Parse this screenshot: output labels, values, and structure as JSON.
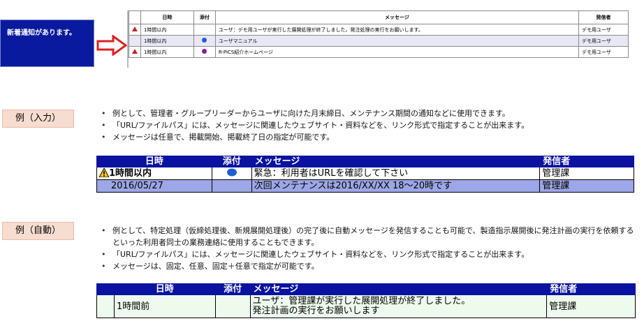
{
  "notification": {
    "text": "新着通知があります。"
  },
  "small_table": {
    "headers": [
      "",
      "日時",
      "添付",
      "メッセージ",
      "発信者"
    ],
    "rows": [
      {
        "icon": "warning-icon",
        "time": "1時間以内",
        "attach": "",
        "message": "ユーザ：デモ用ユーザが実行した展開処理が終了しました。発注処理の実行をお願いします。",
        "sender": "デモ用ユーザ"
      },
      {
        "icon": "",
        "time": "1時間以内",
        "attach": "blue-dot-icon",
        "message": "ユーザマニュアル",
        "sender": "デモ用ユーザ"
      },
      {
        "icon": "warning-icon",
        "time": "1時間以内",
        "attach": "purple-dot-icon",
        "message": "R-PiCS紹介ホームページ",
        "sender": "デモ用ユーザ"
      }
    ]
  },
  "section_input": {
    "label": "例（入力）",
    "bullets": [
      "例として、管理者・グループリーダーからユーザに向けた月末締日、メンテナンス期間の通知などに使用できます。",
      "「URL/ファイルパス」には、メッセージに関連したウェブサイト・資料などを、リンク形式で指定することが出来ます。",
      "メッセージは任意で、掲載開始、掲載終了日の指定が可能です。"
    ],
    "table": {
      "headers": [
        "日時",
        "添付",
        "メッセージ",
        "発信者"
      ],
      "rows": [
        {
          "icon": "warning-icon",
          "time": "1時間以内",
          "attach": "blue-dot-icon",
          "message": "緊急：利用者はURLを確認して下さい",
          "sender": "管理課"
        },
        {
          "icon": "",
          "time": "2016/05/27",
          "attach": "",
          "message": "次回メンテナンスは2016/XX/XX 18～20時です",
          "sender": "管理課"
        }
      ]
    }
  },
  "section_auto": {
    "label": "例（自動）",
    "bullets": [
      "例として、特定処理（仮締処理後、新規展開処理後）の完了後に自動メッセージを発信することも可能で、製造指示展開後に発注計画の実行を依頼するといった利用者同士の業務連絡に使用することもできます。",
      "「URL/ファイルパス」には、メッセージに関連したウェブサイト・資料などを、リンク形式で指定することが出来ます。",
      "メッセージは、固定、任意、固定＋任意で指定が可能です。"
    ],
    "table": {
      "headers": [
        "日時",
        "添付",
        "メッセージ",
        "発信者"
      ],
      "rows": [
        {
          "time": "1時間前",
          "attach": "",
          "message_line1": "ユーザ：管理課が実行した展開処理が終了しました。",
          "message_line2": "発注計画の実行をお願いします",
          "sender": "管理課"
        }
      ]
    }
  },
  "colors": {
    "notif_bg": "#0a1a9e",
    "header_bg": "#0a12a0",
    "row_blue": "#9da6e6",
    "row_green": "#eefaee",
    "label_bg": "#f7dcd0",
    "arrow": "#e02020",
    "warning": "#c0271b",
    "blue_dot": "#1f5fd6",
    "purple_dot": "#8a1a9a"
  }
}
